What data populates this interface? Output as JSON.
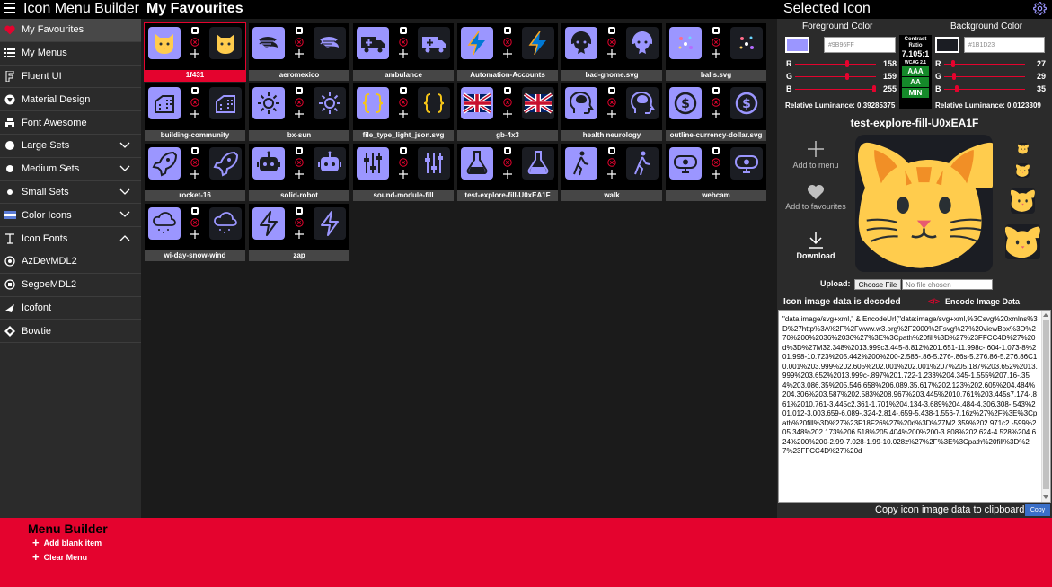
{
  "app": {
    "title": "Icon Menu Builder",
    "page_title": "My Favourites",
    "selected_title": "Selected Icon"
  },
  "sidebar": {
    "items": [
      {
        "label": "My Favourites",
        "icon": "heart-icon",
        "active": true
      },
      {
        "label": "My Menus",
        "icon": "list-icon"
      },
      {
        "label": "Fluent UI",
        "icon": "fluent-icon"
      },
      {
        "label": "Material Design",
        "icon": "material-icon"
      },
      {
        "label": "Font Awesome",
        "icon": "font-awesome-icon"
      },
      {
        "label": "Large Sets",
        "icon": "large-dot-icon",
        "chevron": "down"
      },
      {
        "label": "Medium Sets",
        "icon": "medium-dot-icon",
        "chevron": "down"
      },
      {
        "label": "Small Sets",
        "icon": "small-dot-icon",
        "chevron": "down"
      },
      {
        "label": "Color Icons",
        "icon": "flag-icon",
        "chevron": "down"
      },
      {
        "label": "Icon Fonts",
        "icon": "font-icon",
        "chevron": "up"
      },
      {
        "label": "AzDevMDL2",
        "icon": "azdev-icon"
      },
      {
        "label": "SegoeMDL2",
        "icon": "segoe-icon"
      },
      {
        "label": "Icofont",
        "icon": "icofont-icon"
      },
      {
        "label": "Bowtie",
        "icon": "bowtie-icon"
      }
    ]
  },
  "favourites": [
    {
      "label": "1f431",
      "icon": "cat-face",
      "brand": "twitter-icon",
      "selected": true
    },
    {
      "label": "aeromexico",
      "icon": "aeromexico",
      "brand": "simple-icons-icon"
    },
    {
      "label": "ambulance",
      "icon": "ambulance",
      "brand": "font-awesome-icon"
    },
    {
      "label": "Automation-Accounts",
      "icon": "automation-bolt",
      "brand": "microsoft-icon"
    },
    {
      "label": "bad-gnome.svg",
      "icon": "bad-gnome",
      "brand": "gear-icon"
    },
    {
      "label": "balls.svg",
      "icon": "balls",
      "brand": "sun-icon"
    },
    {
      "label": "building-community",
      "icon": "building",
      "brand": "tabler-icon"
    },
    {
      "label": "bx-sun",
      "icon": "sun",
      "brand": "boxicons-icon"
    },
    {
      "label": "file_type_light_json.svg",
      "icon": "json-braces",
      "brand": "vscode-icon"
    },
    {
      "label": "gb-4x3",
      "icon": "uk-flag",
      "brand": "flag-icons-icon"
    },
    {
      "label": "health neurology",
      "icon": "head-brain",
      "brand": "health-icon"
    },
    {
      "label": "outline-currency-dollar.svg",
      "icon": "dollar-coin",
      "brand": "shield-icon"
    },
    {
      "label": "rocket-16",
      "icon": "rocket",
      "brand": "octicon-icon"
    },
    {
      "label": "solid-robot",
      "icon": "robot",
      "brand": "svg-icon"
    },
    {
      "label": "sound-module-fill",
      "icon": "sliders",
      "brand": "remix-icon"
    },
    {
      "label": "test-explore-fill-U0xEA1F",
      "icon": "flask",
      "brand": "fluent-icon"
    },
    {
      "label": "walk",
      "icon": "walk",
      "brand": "walk-brand-icon"
    },
    {
      "label": "webcam",
      "icon": "webcam",
      "brand": "bootstrap-icon"
    },
    {
      "label": "wi-day-snow-wind",
      "icon": "weather-snow",
      "brand": "weather-icon"
    },
    {
      "label": "zap",
      "icon": "zap",
      "brand": "feather-icon"
    }
  ],
  "colors": {
    "foreground_label": "Foreground Color",
    "background_label": "Background Color",
    "fg_hex": "#9B96FF",
    "bg_hex": "#1B1D23",
    "fg": {
      "r": 158,
      "g": 159,
      "b": 255
    },
    "bg": {
      "r": 27,
      "g": 29,
      "b": 35
    },
    "fg_luminance_label": "Relative Luminance: 0.39285375",
    "bg_luminance_label": "Relative Luminance: 0.0123309",
    "accent": "#e4032e",
    "fg_swatch": "#9b96ff",
    "bg_swatch": "#1b1d23"
  },
  "contrast": {
    "title": "Contrast Ratio",
    "ratio": "7.105:1",
    "wcag": "WCAG 2.1",
    "badges": [
      "AAA",
      "AA",
      "MIN"
    ]
  },
  "selected": {
    "name": "test-explore-fill-U0xEA1F",
    "add_to_menu": "Add to menu",
    "add_to_favourites": "Add to favourites",
    "download": "Download",
    "upload_label": "Upload:",
    "file_button": "Choose File",
    "file_status": "No file chosen",
    "decoded_label": "Icon image data is decoded",
    "encode_label": "Encode Image Data",
    "data_text": "\"data:image/svg+xml,\" & EncodeUrl(\"data:image/svg+xml,%3Csvg%20xmlns%3D%27http%3A%2F%2Fwww.w3.org%2F2000%2Fsvg%27%20viewBox%3D%270%200%2036%2036%27%3E%3Cpath%20fill%3D%27%23FFCC4D%27%20d%3D%27M32.348%2013.999c3.445-8.812%201.651-11.998c-.604-1.073-8%201.998-10.723%205.442%200%200-2.586-.86-5.276-.86s-5.276.86-5.276.86C10.001%203.999%202.605%202.001%202.001%207%205.187%203.652%2013.999%203.652%2013.999c-.897%201.722-1.233%204.345-1.555%207.16-.354%203.086.35%205.546.658%206.089.35.617%202.123%202.605%204.484%204.306%203.587%202.583%208.967%203.445%2010.761%203.445s7.174-.861%2010.761-3.445c2.361-1.701%204.134-3.689%204.484-4.306.308-.543%201.012-3.003.659-6.089-.324-2.814-.659-5.438-1.556-7.16z%27%2F%3E%3Cpath%20fill%3D%27%23F18F26%27%20d%3D%27M2.359%202.971c2.-599%205.348%202.173%206.518%205.404%200%200-3.808%202.624-4.528%204.624%200%200-2.99-7.028-1.99-10.028z%27%2F%3E%3Cpath%20fill%3D%27%23FFCC4D%27%20d",
    "copy_label": "Copy icon image data to clipboard:",
    "copy_button": "Copy"
  },
  "menu_builder": {
    "title": "Menu Builder",
    "items": [
      "Add blank item",
      "Clear Menu"
    ]
  }
}
